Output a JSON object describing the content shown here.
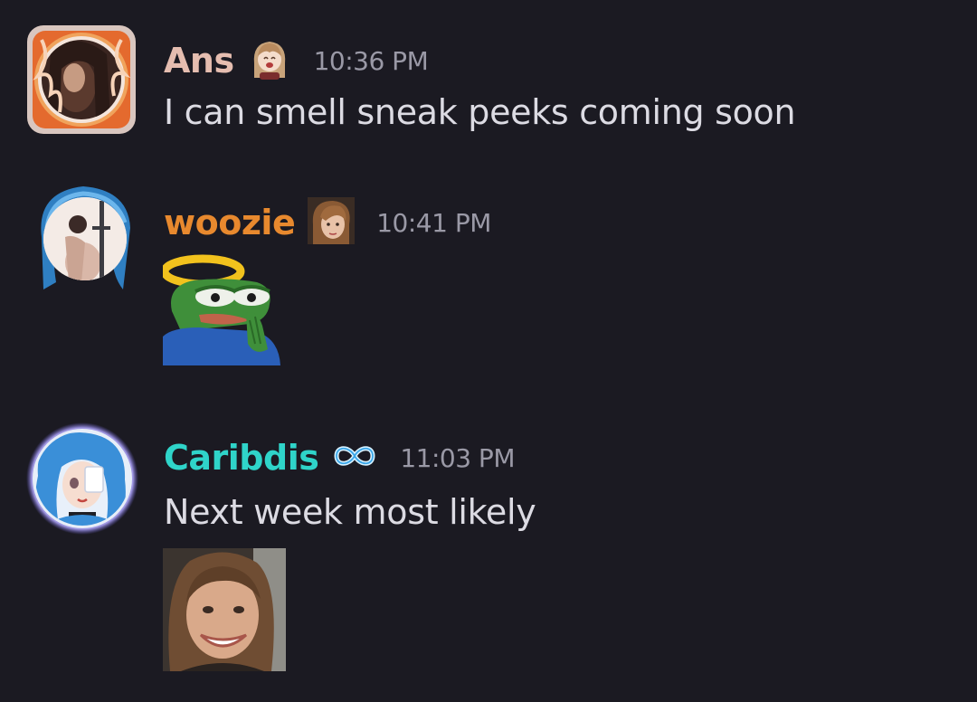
{
  "messages": [
    {
      "username": "Ans",
      "username_color": "#e5bdb0",
      "role_icon": "girl-sticker-icon",
      "timestamp": "10:36 PM",
      "text": "I can smell sneak peeks coming soon",
      "avatar": "flame-frame-avatar"
    },
    {
      "username": "woozie",
      "username_color": "#e8892e",
      "role_icon": "portrait-icon",
      "timestamp": "10:41 PM",
      "text": "",
      "sticker": "angel-pepe-sticker",
      "avatar": "blue-frame-avatar"
    },
    {
      "username": "Caribdis",
      "username_color": "#2fd4c9",
      "role_icon": "infinity-icon",
      "timestamp": "11:03 PM",
      "text": "Next week most likely",
      "attachment": "smiling-face-photo",
      "avatar": "blue-hair-avatar"
    }
  ]
}
